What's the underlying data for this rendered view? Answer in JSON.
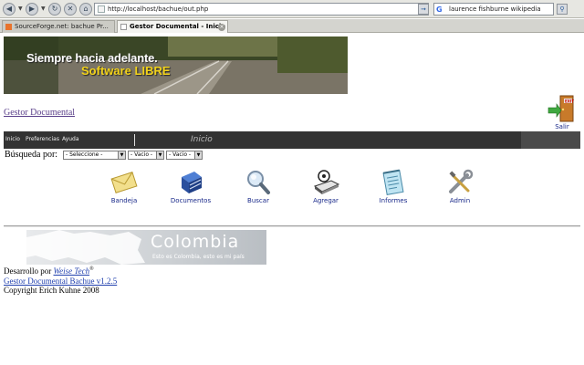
{
  "browser": {
    "url": "http://localhost/bachue/out.php",
    "search_text": "laurence fishburne wikipedia",
    "search_engine_glyph": "G",
    "tabs": [
      {
        "label": "SourceForge.net: bachue Pr...",
        "active": false
      },
      {
        "label": "Gestor Documental - Inicio",
        "active": true
      }
    ]
  },
  "banner": {
    "line1": "Siempre hacia adelante.",
    "line2": "Software LIBRE"
  },
  "header": {
    "home_link": "Gestor Documental",
    "salir_label": "Salir"
  },
  "menu": {
    "items": [
      "Inicio",
      "Preferencias",
      "Ayuda"
    ],
    "current": "Inicio"
  },
  "search": {
    "label": "Búsqueda por:",
    "selects": [
      "- Seleccione -",
      "- Vacio -",
      "- Vacio -"
    ]
  },
  "tools": [
    {
      "label": "Bandeja",
      "icon": "envelope-icon"
    },
    {
      "label": "Documentos",
      "icon": "books-icon"
    },
    {
      "label": "Buscar",
      "icon": "magnifier-icon"
    },
    {
      "label": "Agregar",
      "icon": "scanner-icon"
    },
    {
      "label": "Informes",
      "icon": "notepad-icon"
    },
    {
      "label": "Admin",
      "icon": "tools-icon"
    }
  ],
  "colombia": {
    "name": "Colombia",
    "tagline": "Esto es Colombia, esto es mi país"
  },
  "footer": {
    "dev_prefix": "Desarrollo por",
    "dev_name": "Weise Tech",
    "dev_mark": "®",
    "version_link": "Gestor Documental Bachue v1.2.5",
    "copyright": "Copyright Erich Kuhne 2008"
  },
  "colors": {
    "menu_bg": "#333333",
    "link_color": "#1f3fae",
    "banner_yellow": "#f2d21a"
  }
}
